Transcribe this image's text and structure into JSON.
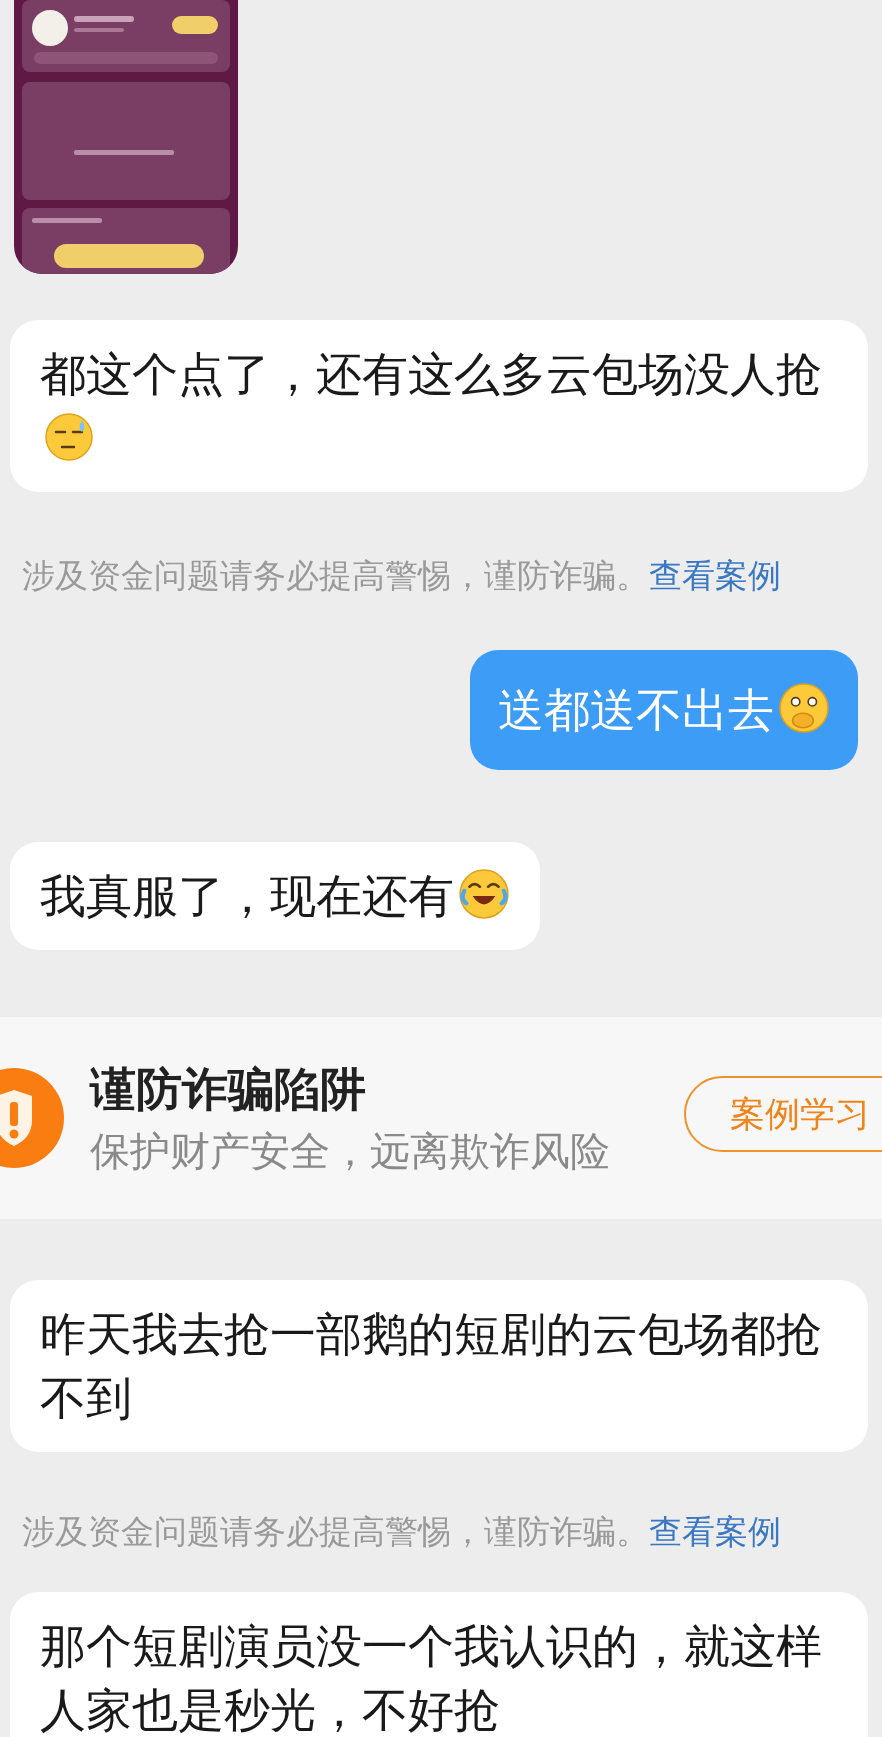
{
  "messages": [
    {
      "kind": "received",
      "text": "都这个点了，还有这么多云包场没人抢",
      "emoji": {
        "kind": "sweat"
      }
    },
    {
      "kind": "notice",
      "text": "涉及资金问题请务必提高警惕，谨防诈骗。",
      "link": "查看案例"
    },
    {
      "kind": "sent",
      "text": "送都送不出去",
      "emoji": {
        "kind": "cover-mouth"
      }
    },
    {
      "kind": "received",
      "text": "我真服了，现在还有",
      "emoji": {
        "kind": "laugh-cry"
      }
    },
    {
      "kind": "banner",
      "title": "谨防诈骗陷阱",
      "subtitle": "保护财产安全，远离欺诈风险",
      "button": "案例学习"
    },
    {
      "kind": "received",
      "text": "昨天我去抢一部鹅的短剧的云包场都抢不到"
    },
    {
      "kind": "notice",
      "text": "涉及资金问题请务必提高警惕，谨防诈骗。",
      "link": "查看案例"
    },
    {
      "kind": "received",
      "text": "那个短剧演员没一个我认识的，就这样人家也是秒光，不好抢"
    }
  ]
}
